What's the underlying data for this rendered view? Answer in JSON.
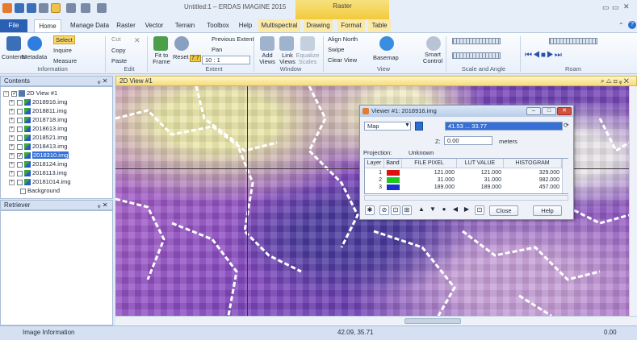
{
  "title_bar": {
    "window_title": "Untitled:1 – ERDAS IMAGINE 2015",
    "context_tab": "Raster"
  },
  "tabs": [
    {
      "label": "File"
    },
    {
      "label": "Home"
    },
    {
      "label": "Manage Data"
    },
    {
      "label": "Raster"
    },
    {
      "label": "Vector"
    },
    {
      "label": "Terrain"
    },
    {
      "label": "Toolbox"
    },
    {
      "label": "Help"
    },
    {
      "label": "Multispectral"
    },
    {
      "label": "Drawing"
    },
    {
      "label": "Format"
    },
    {
      "label": "Table"
    }
  ],
  "ribbon": {
    "information": {
      "label": "Information",
      "contents": "Contents",
      "metadata": "Metadata",
      "select": "Select",
      "inquire": "Inquire",
      "measure": "Measure"
    },
    "edit": {
      "label": "Edit",
      "cut": "Cut",
      "copy": "Copy",
      "paste": "Paste"
    },
    "extent": {
      "label": "Extent",
      "fit_to_frame": "Fit to Frame",
      "reset": "Reset",
      "previous_extent": "Previous Extent",
      "pan": "Pan",
      "scale": "10 : 1",
      "ratio_icon": "7:7"
    },
    "window": {
      "label": "Window",
      "add_views": "Add Views",
      "link_views": "Link Views",
      "equalize_scales": "Equalize Scales"
    },
    "view": {
      "label": "View",
      "align_north": "Align North",
      "swipe": "Swipe",
      "clear_view": "Clear View",
      "basemap": "Basemap",
      "smart_control": "Smart Control"
    },
    "scale_angle": {
      "label": "Scale and Angle"
    },
    "roam": {
      "label": "Roam"
    }
  },
  "contents": {
    "header": "Contents",
    "pin": "ᵩ x",
    "root": "2D View #1",
    "layers": [
      {
        "name": "2018916.img",
        "checked": false
      },
      {
        "name": "2018811.img",
        "checked": false
      },
      {
        "name": "2018718.img",
        "checked": false
      },
      {
        "name": "2018613.img",
        "checked": false
      },
      {
        "name": "2018521.img",
        "checked": false
      },
      {
        "name": "2018413.img",
        "checked": false
      },
      {
        "name": "2018310.img",
        "checked": true,
        "selected": true
      },
      {
        "name": "2018124.img",
        "checked": false
      },
      {
        "name": "2018113.img",
        "checked": false
      },
      {
        "name": "20181014.img",
        "checked": false
      }
    ],
    "background": "Background"
  },
  "retriever": {
    "header": "Retriever",
    "pin": "ᵩ x"
  },
  "view": {
    "tab": "2D View #1"
  },
  "viewer_dialog": {
    "title": "Viewer #1: 2018916.img",
    "mode": "Map",
    "coords": "41.53 ... 33.77",
    "z_label": "Z:",
    "z_value": "0.00",
    "units": "meters",
    "projection_label": "Projection:",
    "projection_value": "Unknown",
    "table": {
      "headers": [
        "Layer",
        "Band",
        "FILE PIXEL",
        "LUT VALUE",
        "HISTOGRAM"
      ],
      "rows": [
        {
          "layer": "1",
          "band_color": "#e01010",
          "file_pixel": "121.000",
          "lut_value": "121.000",
          "histogram": "329.000"
        },
        {
          "layer": "2",
          "band_color": "#22c522",
          "file_pixel": "31.000",
          "lut_value": "31.000",
          "histogram": "982.000"
        },
        {
          "layer": "3",
          "band_color": "#1a2fd0",
          "file_pixel": "189.000",
          "lut_value": "189.000",
          "histogram": "457.000"
        }
      ]
    },
    "close_label": "Close",
    "help_label": "Help"
  },
  "status_bar": {
    "left": "Image Information",
    "coords": "42.09, 35.71",
    "right": "0.00"
  },
  "colors": {
    "file_tab": "#2b5fb4",
    "accent": "#f3c93c"
  }
}
